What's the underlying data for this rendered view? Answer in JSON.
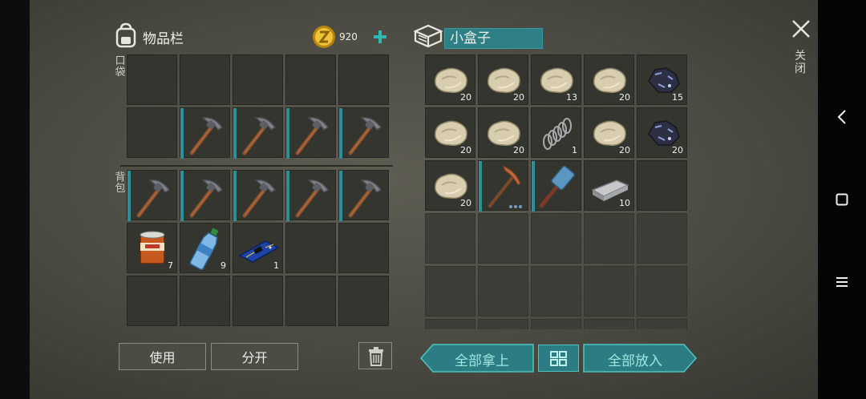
{
  "inventory": {
    "title": "物品栏",
    "coins": "920",
    "pocket_label": "口袋",
    "backpack_label": "背包"
  },
  "container": {
    "title": "小盒子"
  },
  "close_label": "关闭",
  "buttons": {
    "use": "使用",
    "split": "分开",
    "take_all": "全部拿上",
    "put_all": "全部放入"
  },
  "inventory_slots": [
    {
      "item": "",
      "count": ""
    },
    {
      "item": "",
      "count": ""
    },
    {
      "item": "",
      "count": ""
    },
    {
      "item": "",
      "count": ""
    },
    {
      "item": "",
      "count": ""
    },
    {
      "item": "",
      "count": ""
    },
    {
      "item": "pickaxe",
      "count": ""
    },
    {
      "item": "pickaxe",
      "count": ""
    },
    {
      "item": "pickaxe",
      "count": ""
    },
    {
      "item": "pickaxe",
      "count": ""
    },
    {
      "item": "pickaxe",
      "count": ""
    },
    {
      "item": "pickaxe",
      "count": ""
    },
    {
      "item": "pickaxe",
      "count": ""
    },
    {
      "item": "pickaxe",
      "count": ""
    },
    {
      "item": "pickaxe",
      "count": ""
    },
    {
      "item": "food-can",
      "count": "7"
    },
    {
      "item": "water-bottle",
      "count": "9"
    },
    {
      "item": "circuit-board",
      "count": "1"
    },
    {
      "item": "",
      "count": ""
    },
    {
      "item": "",
      "count": ""
    },
    {
      "item": "",
      "count": ""
    },
    {
      "item": "",
      "count": ""
    },
    {
      "item": "",
      "count": ""
    },
    {
      "item": "",
      "count": ""
    },
    {
      "item": "",
      "count": ""
    }
  ],
  "container_slots": [
    {
      "item": "stone",
      "count": "20"
    },
    {
      "item": "stone",
      "count": "20"
    },
    {
      "item": "stone",
      "count": "13"
    },
    {
      "item": "stone",
      "count": "20"
    },
    {
      "item": "iron-ore",
      "count": "15"
    },
    {
      "item": "stone",
      "count": "20"
    },
    {
      "item": "stone",
      "count": "20"
    },
    {
      "item": "spring",
      "count": "1"
    },
    {
      "item": "stone",
      "count": "20"
    },
    {
      "item": "iron-ore",
      "count": "20"
    },
    {
      "item": "stone",
      "count": "20"
    },
    {
      "item": "copper-pickaxe",
      "count": ""
    },
    {
      "item": "sledgehammer",
      "count": ""
    },
    {
      "item": "iron-ingot",
      "count": "10"
    },
    {
      "item": "",
      "count": ""
    },
    {
      "item": "",
      "count": ""
    },
    {
      "item": "",
      "count": ""
    },
    {
      "item": "",
      "count": ""
    },
    {
      "item": "",
      "count": ""
    },
    {
      "item": "",
      "count": ""
    },
    {
      "item": "",
      "count": ""
    },
    {
      "item": "",
      "count": ""
    },
    {
      "item": "",
      "count": ""
    },
    {
      "item": "",
      "count": ""
    },
    {
      "item": "",
      "count": ""
    },
    {
      "item": "",
      "count": ""
    },
    {
      "item": "",
      "count": ""
    },
    {
      "item": "",
      "count": ""
    },
    {
      "item": "",
      "count": ""
    },
    {
      "item": "",
      "count": ""
    }
  ],
  "colors": {
    "accent": "#2c8f9a",
    "bg": "#4a4a42",
    "slot": "#34352f"
  }
}
